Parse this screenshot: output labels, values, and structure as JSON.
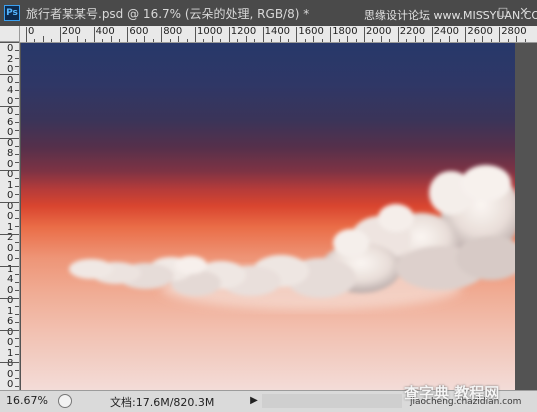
{
  "window": {
    "app_icon_label": "Ps",
    "title": "旅行者某某号.psd @ 16.7% (云朵的处理, RGB/8) *",
    "watermark_top": "思缘设计论坛 www.MISSYUAN.COM",
    "controls": {
      "minimize": "–",
      "maximize": "□",
      "close": "✕"
    }
  },
  "ruler": {
    "top_labels": [
      "0",
      "200",
      "400",
      "600",
      "800",
      "1000",
      "1200",
      "1400",
      "1600",
      "1800",
      "2000",
      "2200",
      "2400",
      "2600",
      "2800"
    ],
    "left_labels": [
      "0",
      "2",
      "0",
      "0",
      "4",
      "0",
      "0",
      "6",
      "0",
      "0",
      "8",
      "0",
      "0",
      "1",
      "0",
      "0",
      "0",
      "1",
      "2",
      "0",
      "0",
      "1",
      "4",
      "0",
      "0",
      "1",
      "6",
      "0",
      "0",
      "1",
      "8",
      "0",
      "0"
    ]
  },
  "canvas": {
    "layer": "云朵的处理"
  },
  "status": {
    "zoom": "16.67%",
    "doc_info": "文档:17.6M/820.3M",
    "arrow": "▶"
  },
  "watermark_bottom": {
    "big": "查字典 教程网",
    "small": "jiaocheng.chazidian.com"
  }
}
